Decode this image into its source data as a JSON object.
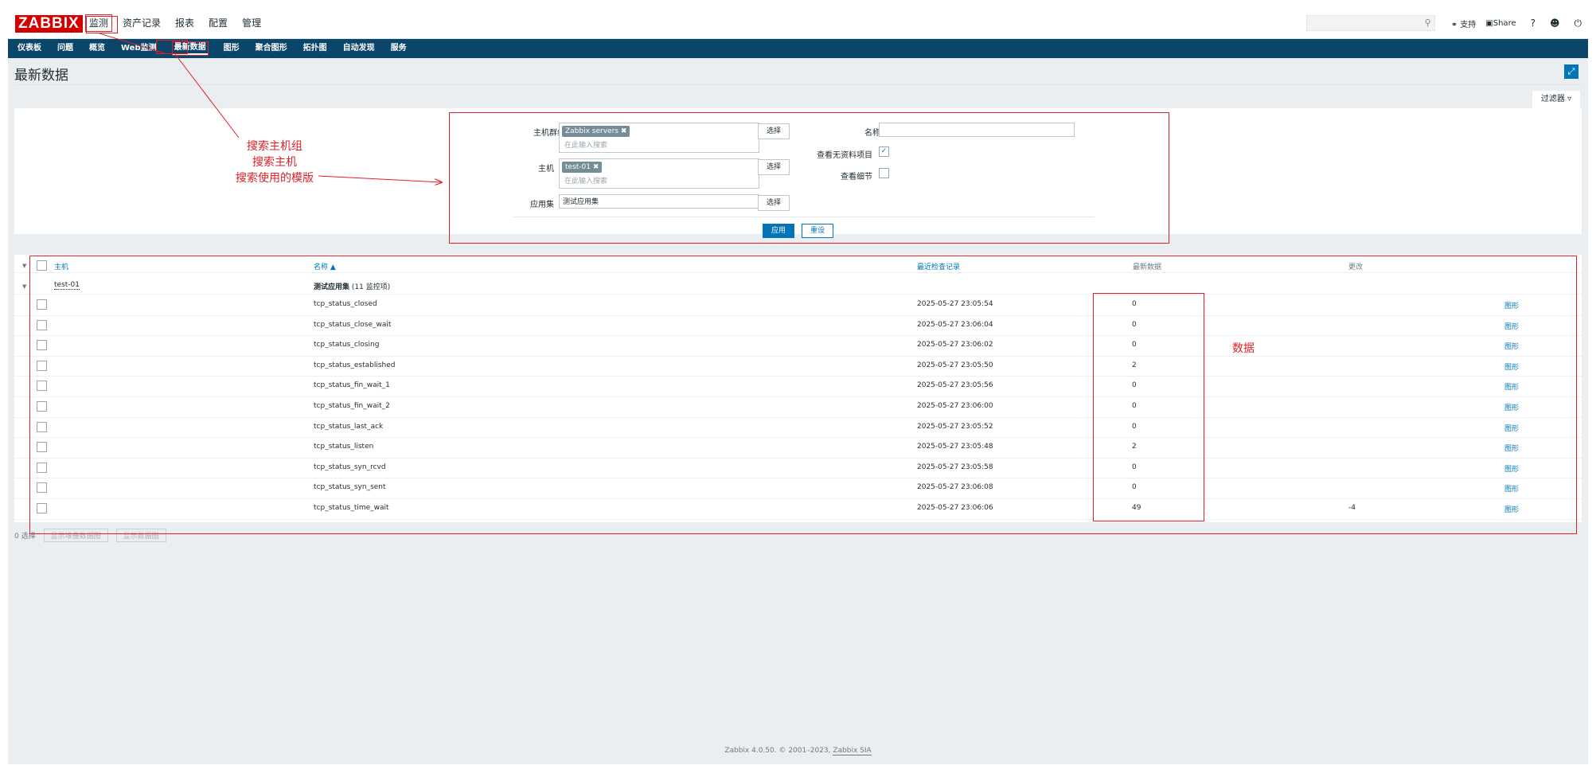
{
  "app": {
    "logo": "ZABBIX"
  },
  "main_menu": [
    "监测",
    "资产记录",
    "报表",
    "配置",
    "管理"
  ],
  "main_menu_active": "监测",
  "top_right": {
    "support": "支持",
    "share": "Share",
    "help": "?"
  },
  "sub_menu": [
    "仪表板",
    "问题",
    "概览",
    "Web监测",
    "最新数据",
    "图形",
    "聚合图形",
    "拓扑图",
    "自动发现",
    "服务"
  ],
  "sub_menu_active": "最新数据",
  "page_title": "最新数据",
  "filter": {
    "tab_label": "过滤器",
    "host_group_label": "主机群组",
    "host_group_chip": "Zabbix servers",
    "host_label": "主机",
    "host_chip": "test-01",
    "placeholder": "在此输入搜索",
    "select_label": "选择",
    "app_label": "应用集",
    "app_value": "测试应用集",
    "name_label": "名称",
    "show_no_data_label": "查看无资料项目",
    "show_details_label": "查看细节",
    "apply_label": "应用",
    "reset_label": "重设"
  },
  "table": {
    "headers": {
      "host": "主机",
      "name": "名称 ▲",
      "last_check": "最近检查记录",
      "last_value": "最新数据",
      "change": "更改"
    },
    "group_host": "test-01",
    "group_app": "测试应用集",
    "group_count": "(11 监控项)",
    "rows": [
      {
        "name": "tcp_status_closed",
        "last_check": "2025-05-27 23:05:54",
        "last_value": "0",
        "change": "",
        "action": "图形"
      },
      {
        "name": "tcp_status_close_wait",
        "last_check": "2025-05-27 23:06:04",
        "last_value": "0",
        "change": "",
        "action": "图形"
      },
      {
        "name": "tcp_status_closing",
        "last_check": "2025-05-27 23:06:02",
        "last_value": "0",
        "change": "",
        "action": "图形"
      },
      {
        "name": "tcp_status_established",
        "last_check": "2025-05-27 23:05:50",
        "last_value": "2",
        "change": "",
        "action": "图形"
      },
      {
        "name": "tcp_status_fin_wait_1",
        "last_check": "2025-05-27 23:05:56",
        "last_value": "0",
        "change": "",
        "action": "图形"
      },
      {
        "name": "tcp_status_fin_wait_2",
        "last_check": "2025-05-27 23:06:00",
        "last_value": "0",
        "change": "",
        "action": "图形"
      },
      {
        "name": "tcp_status_last_ack",
        "last_check": "2025-05-27 23:05:52",
        "last_value": "0",
        "change": "",
        "action": "图形"
      },
      {
        "name": "tcp_status_listen",
        "last_check": "2025-05-27 23:05:48",
        "last_value": "2",
        "change": "",
        "action": "图形"
      },
      {
        "name": "tcp_status_syn_rcvd",
        "last_check": "2025-05-27 23:05:58",
        "last_value": "0",
        "change": "",
        "action": "图形"
      },
      {
        "name": "tcp_status_syn_sent",
        "last_check": "2025-05-27 23:06:08",
        "last_value": "0",
        "change": "",
        "action": "图形"
      },
      {
        "name": "tcp_status_time_wait",
        "last_check": "2025-05-27 23:06:06",
        "last_value": "49",
        "change": "-4",
        "action": "图形"
      }
    ]
  },
  "footer_actions": {
    "selected": "0 选择",
    "stacked_graph": "显示堆叠数据图",
    "graph": "显示数据图"
  },
  "copyright": {
    "text": "Zabbix 4.0.50. © 2001–2023, ",
    "link": "Zabbix SIA"
  },
  "annotations": {
    "search_lines": [
      "搜索主机组",
      "搜索主机",
      "搜索使用的模版"
    ],
    "data_label": "数据"
  },
  "colors": {
    "brand": "#d40000",
    "nav": "#0a466a",
    "accent": "#0275b8",
    "annotation": "#e0202a"
  },
  "icons": {
    "search": "search-icon",
    "support": "headset-icon",
    "share": "share-icon",
    "user": "user-icon",
    "logout": "power-icon",
    "fullscreen": "fullscreen-icon",
    "filter": "funnel-icon"
  }
}
